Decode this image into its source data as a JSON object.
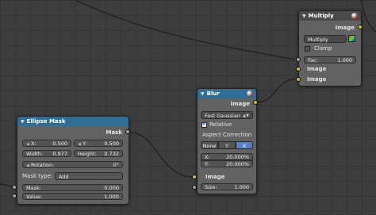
{
  "multiply": {
    "title": "Multiply",
    "output": "Image",
    "blend_type": "Multiply",
    "clamp_label": "Clamp",
    "clamp_checked": false,
    "fac_label": "Fac:",
    "fac_value": "1.000",
    "inputs": [
      "Image",
      "Image"
    ]
  },
  "blur": {
    "title": "Blur",
    "output": "Image",
    "filter_type": "Fast Gaussian",
    "relative_label": "Relative",
    "relative_checked": true,
    "aspect_label": "Aspect Correction",
    "aspect_options": [
      "None",
      "Y",
      "X"
    ],
    "aspect_selected": "X",
    "x_label": "X:",
    "x_value": "20.000%",
    "y_label": "Y:",
    "y_value": "20.000%",
    "input": "Image",
    "size_label": "Size:",
    "size_value": "1.000"
  },
  "ellipse": {
    "title": "Ellipse Mask",
    "output": "Mask",
    "x_label": "X:",
    "x_value": "0.500",
    "y_label": "Y:",
    "y_value": "0.500",
    "width_label": "Width:",
    "width_value": "0.977",
    "height_label": "Height:",
    "height_value": "0.732",
    "rotation_label": "Rotation:",
    "rotation_value": "0°",
    "mask_type_label": "Mask type:",
    "mask_type_value": "Add",
    "mask_label": "Mask:",
    "mask_value": "0.000",
    "value_label": "Value:",
    "value_value": "1.000"
  },
  "colors": {
    "socket_image": "#c7c729",
    "socket_value": "#a1a1a1",
    "header_output": "#2f6f97",
    "header_converter": "#4a4a4a"
  }
}
